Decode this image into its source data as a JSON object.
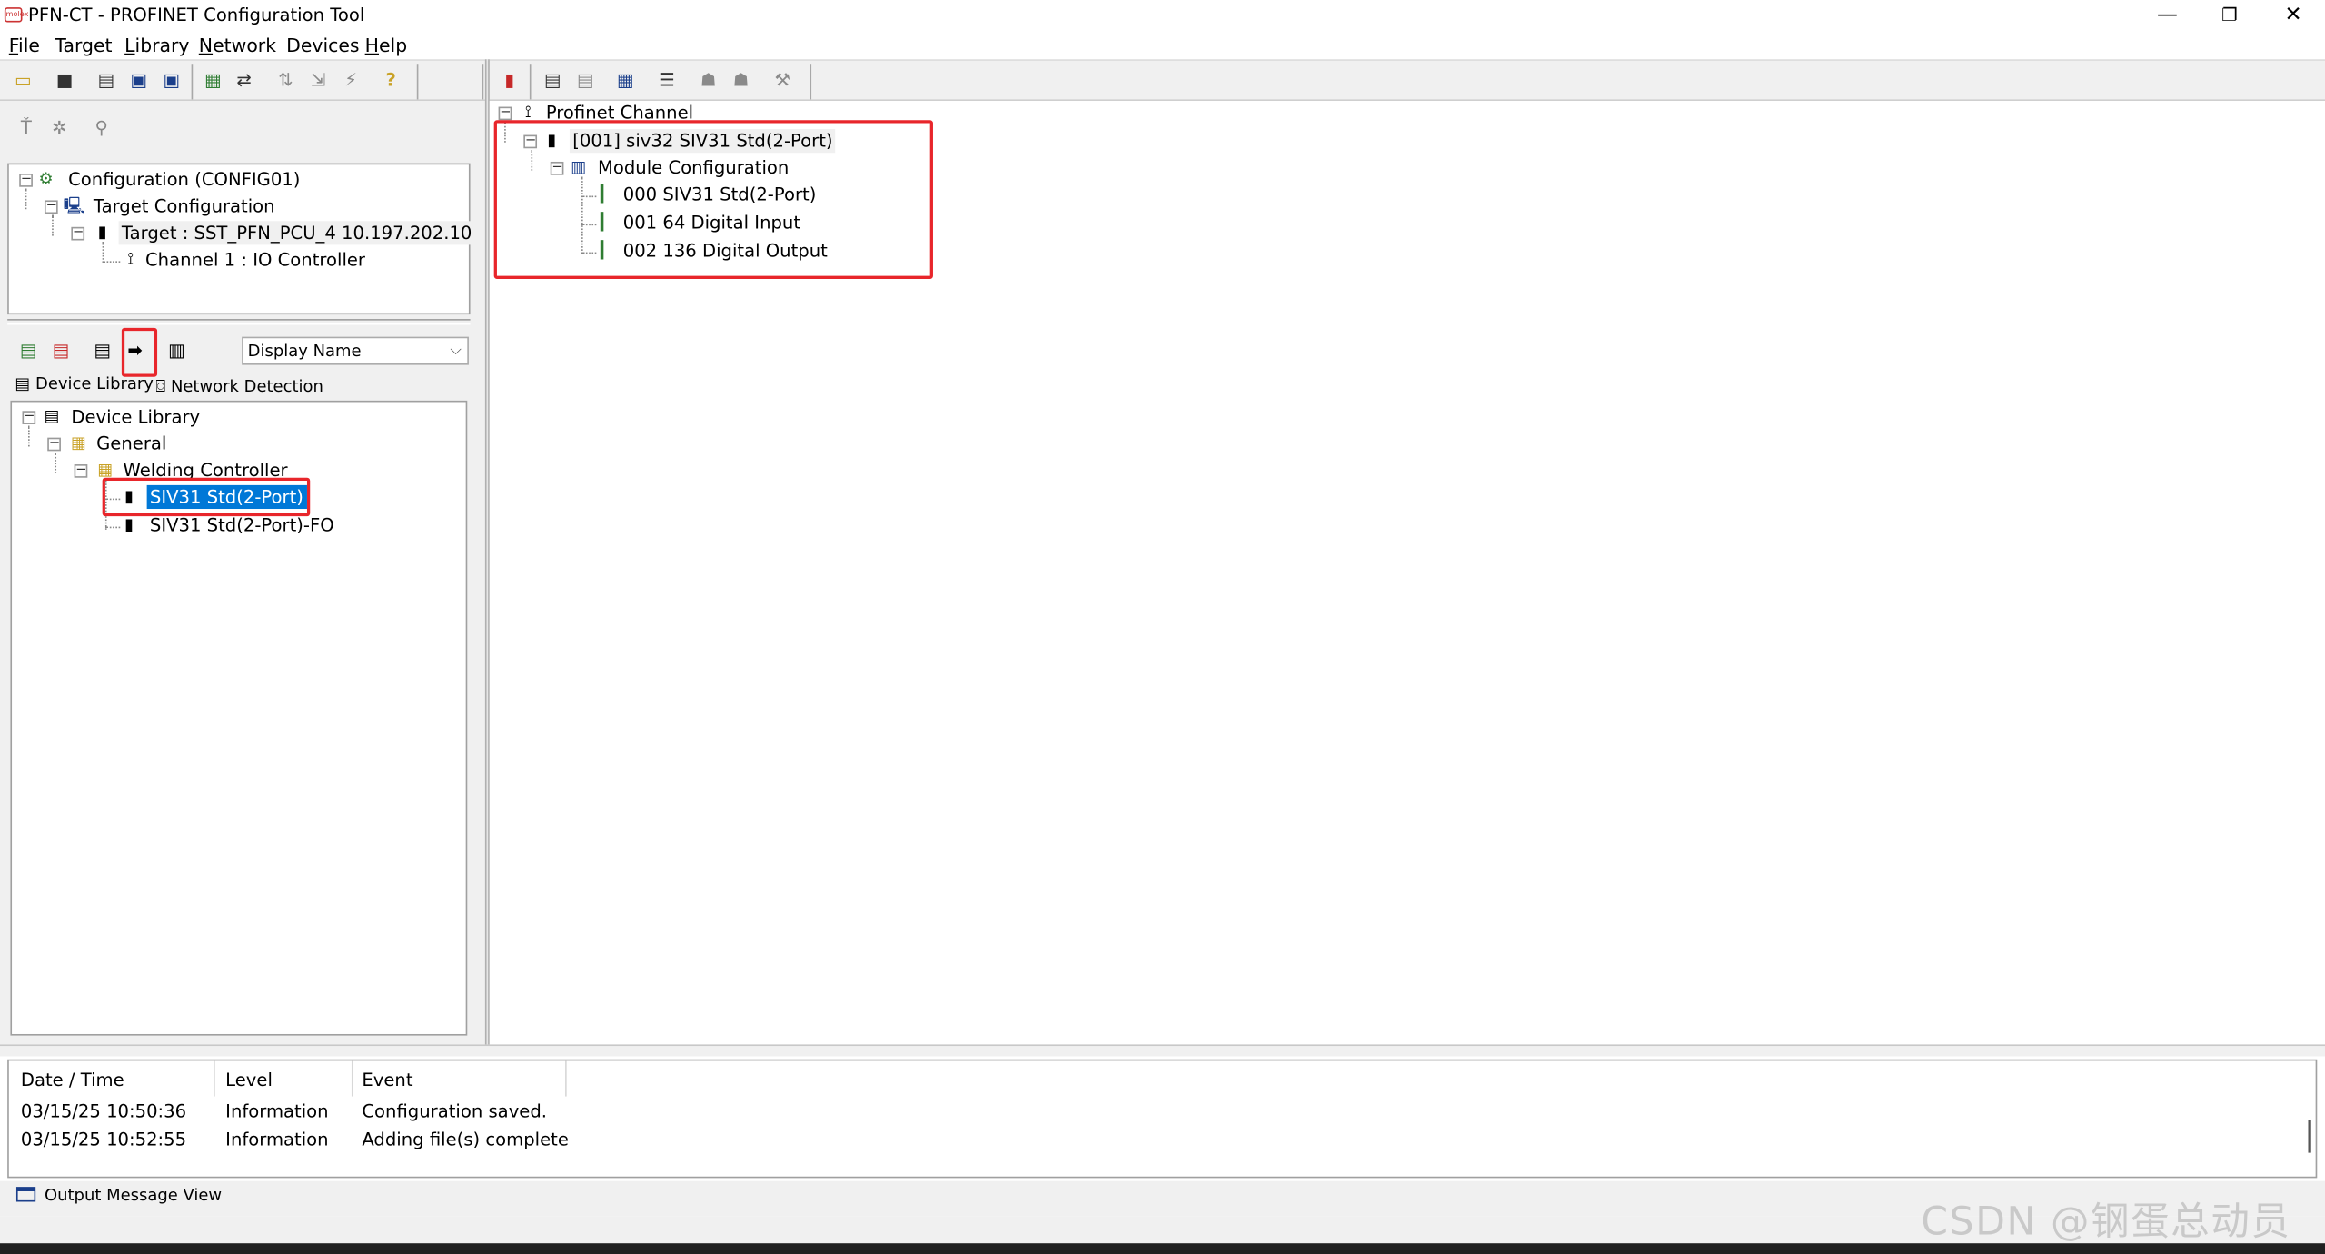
{
  "window": {
    "title": "PFN-CT - PROFINET Configuration Tool",
    "logo_text": "molex",
    "controls": {
      "minimize": "—",
      "maximize": "❐",
      "close": "✕"
    }
  },
  "menu": [
    {
      "label": "File",
      "accel": "F",
      "rest": "ile"
    },
    {
      "label": "Target",
      "accel": "",
      "rest": "Target"
    },
    {
      "label": "Library",
      "accel": "L",
      "rest": "ibrary"
    },
    {
      "label": "Network",
      "accel": "N",
      "rest": "etwork"
    },
    {
      "label": "Devices",
      "accel": "",
      "rest": "Devices"
    },
    {
      "label": "Help",
      "accel": "H",
      "rest": "elp"
    }
  ],
  "config_tree": {
    "root": "Configuration (CONFIG01)",
    "target_configuration": "Target Configuration",
    "target": "Target : SST_PFN_PCU_4  10.197.202.10",
    "channel": "Channel 1 : IO Controller"
  },
  "library": {
    "display_select": "Display Name",
    "tabs": [
      "Device Library",
      "Network Detection"
    ],
    "tree": {
      "root": "Device Library",
      "general": "General",
      "category": "Welding Controller",
      "devices": [
        "SIV31 Std(2-Port)",
        "SIV31 Std(2-Port)-FO"
      ],
      "selected_index": 0
    }
  },
  "network_tree": {
    "channel": "Profinet Channel",
    "device": "[001] siv32   SIV31 Std(2-Port)",
    "module_config": "Module Configuration",
    "modules": [
      "000 SIV31 Std(2-Port)",
      "001 64 Digital Input",
      "002 136 Digital Output"
    ]
  },
  "output": {
    "columns": [
      "Date / Time",
      "Level",
      "Event"
    ],
    "rows": [
      [
        "03/15/25 10:50:36",
        "Information",
        "Configuration saved."
      ],
      [
        "03/15/25 10:52:55",
        "Information",
        "Adding file(s) complete"
      ]
    ],
    "tab_label": "Output Message View"
  },
  "watermark": "CSDN @钢蛋总动员",
  "colors": {
    "selection": "#0078d7",
    "highlight_box": "#e8262b"
  }
}
